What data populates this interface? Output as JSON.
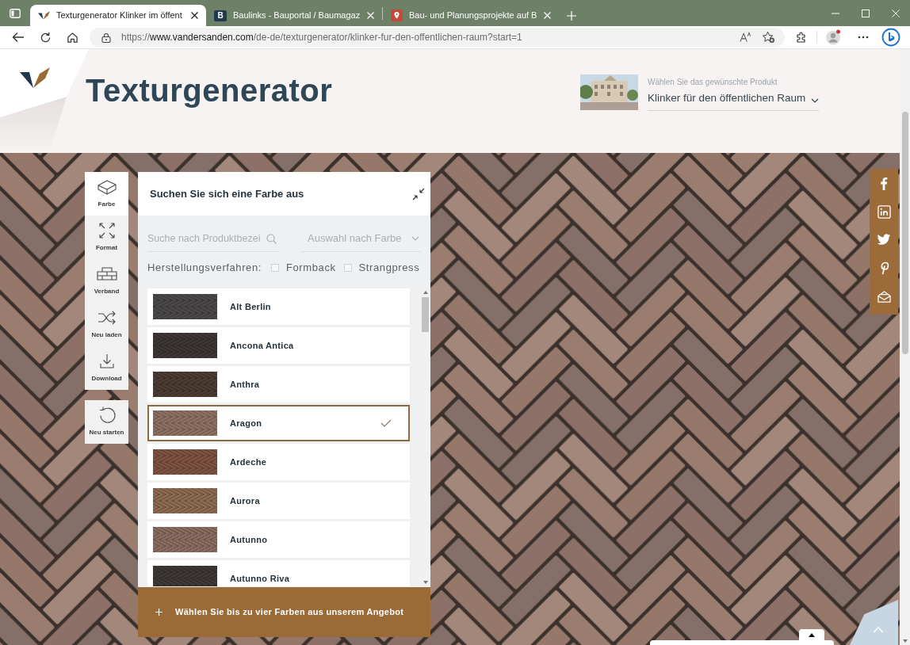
{
  "browser": {
    "tabs": [
      {
        "kind": "logo",
        "title": "Texturgenerator Klinker im öffent",
        "selected": true
      },
      {
        "kind": "letter",
        "icon_text": "B",
        "title": "Baulinks - Bauportal / Baumagaz",
        "selected": false
      },
      {
        "kind": "pin",
        "title": "Bau- und Planungsprojekte auf B",
        "selected": false
      }
    ],
    "url": "https://**www.vandersanden.com**/de-de/texturgenerator/klinker-fur-den-offentlichen-raum?start=1"
  },
  "header": {
    "title": "Texturgenerator",
    "product_picker": {
      "label": "Wählen Sie das gewünschte Produkt",
      "value": "Klinker für den öffentlichen Raum"
    }
  },
  "toolbar": {
    "items": [
      {
        "kind": "color",
        "label": "Farbe",
        "selected": true
      },
      {
        "kind": "format",
        "label": "Format",
        "selected": false
      },
      {
        "kind": "bond",
        "label": "Verband",
        "selected": false
      },
      {
        "kind": "shuffle",
        "label": "Neu laden",
        "selected": false
      },
      {
        "kind": "download",
        "label": "Download",
        "selected": false
      }
    ],
    "restart": {
      "label": "Neu starten"
    }
  },
  "color_panel": {
    "title": "Suchen Sie sich eine Farbe aus",
    "search": {
      "placeholder": "Suche nach Produktbezei"
    },
    "color_filter": {
      "placeholder": "Auswahl nach Farbe"
    },
    "process": {
      "label": "Herstellungsverfahren:",
      "options": [
        {
          "label": "Formback",
          "checked": false
        },
        {
          "label": "Strangpress",
          "checked": false
        }
      ]
    },
    "colors": [
      {
        "name": "Alt Berlin",
        "color": "#4b4848",
        "selected": false
      },
      {
        "name": "Ancona Antica",
        "color": "#3d3735",
        "selected": false
      },
      {
        "name": "Anthra",
        "color": "#4c3c33",
        "selected": false
      },
      {
        "name": "Aragon",
        "color": "#8e7062",
        "selected": true
      },
      {
        "name": "Ardeche",
        "color": "#7e5241",
        "selected": false
      },
      {
        "name": "Aurora",
        "color": "#8c6b52",
        "selected": false
      },
      {
        "name": "Autunno",
        "color": "#8b6c60",
        "selected": false
      },
      {
        "name": "Autunno Riva",
        "color": "#3f3936",
        "selected": false
      }
    ],
    "footer": "Wählen Sie bis zu vier Farben aus unserem Angebot"
  }
}
